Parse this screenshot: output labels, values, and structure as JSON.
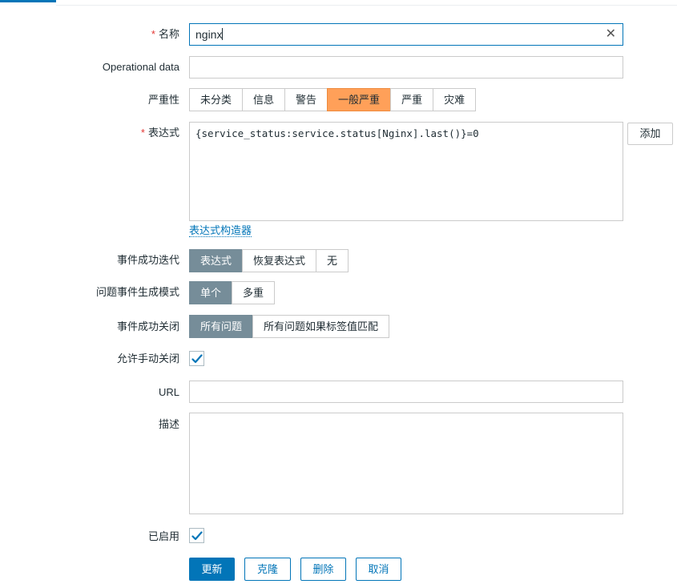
{
  "form": {
    "name": {
      "label": "名称",
      "required_mark": "*",
      "value": "nginx",
      "clear_glyph": "✕"
    },
    "operational_data": {
      "label": "Operational data",
      "value": ""
    },
    "severity": {
      "label": "严重性",
      "options": [
        "未分类",
        "信息",
        "警告",
        "一般严重",
        "严重",
        "灾难"
      ],
      "selected": "一般严重",
      "selected_color": "#ffa059"
    },
    "expression": {
      "label": "表达式",
      "required_mark": "*",
      "value": "{service_status:service.status[Nginx].last()}=0",
      "add_button": "添加",
      "constructor_link": "表达式构造器"
    },
    "ok_event_generation": {
      "label": "事件成功迭代",
      "options": [
        "表达式",
        "恢复表达式",
        "无"
      ],
      "selected": "表达式"
    },
    "problem_event_mode": {
      "label": "问题事件生成模式",
      "options": [
        "单个",
        "多重"
      ],
      "selected": "单个"
    },
    "ok_event_closes": {
      "label": "事件成功关闭",
      "options": [
        "所有问题",
        "所有问题如果标签值匹配"
      ],
      "selected": "所有问题"
    },
    "allow_manual_close": {
      "label": "允许手动关闭",
      "checked": true,
      "icon": "checkmark-icon"
    },
    "url": {
      "label": "URL",
      "value": ""
    },
    "description": {
      "label": "描述",
      "value": ""
    },
    "enabled": {
      "label": "已启用",
      "checked": true,
      "icon": "checkmark-icon"
    }
  },
  "buttons": {
    "update": "更新",
    "clone": "克隆",
    "delete": "删除",
    "cancel": "取消"
  },
  "colors": {
    "accent": "#0275b8",
    "segment_selected": "#768d99",
    "severity_average": "#ffa059",
    "required": "#e33734"
  }
}
